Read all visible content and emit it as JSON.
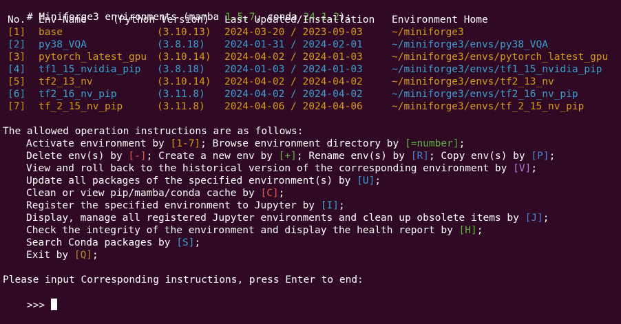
{
  "header": {
    "prefix": "# Miniforge3 environments (mamba ",
    "mamba_version": "1.5.7",
    "middle": ", conda ",
    "conda_version": "24.1.2",
    "suffix": "):"
  },
  "columns": {
    "no": "No.",
    "name": "Env Name",
    "python": "(Python Version)",
    "updated": "Last Updated/Installation",
    "home": "Environment Home"
  },
  "environments": [
    {
      "no": "[1]",
      "name": "base",
      "python": "(3.10.13)",
      "updated": "2024-03-20 / 2023-09-03",
      "home": "~/miniforge3",
      "color": "#d49a1a"
    },
    {
      "no": "[2]",
      "name": "py38_VQA",
      "python": "(3.8.18)",
      "updated": "2024-01-31 / 2024-02-01",
      "home": "~/miniforge3/envs/py38_VQA",
      "color": "#3aa0d0"
    },
    {
      "no": "[3]",
      "name": "pytorch_latest_gpu",
      "python": "(3.10.14)",
      "updated": "2024-04-02 / 2024-01-03",
      "home": "~/miniforge3/envs/pytorch_latest_gpu",
      "color": "#d49a1a"
    },
    {
      "no": "[4]",
      "name": "tf1_15_nvidia_pip",
      "python": "(3.8.18)",
      "updated": "2024-01-03 / 2024-01-03",
      "home": "~/miniforge3/envs/tf1_15_nvidia_pip",
      "color": "#3aa0d0"
    },
    {
      "no": "[5]",
      "name": "tf2_13_nv",
      "python": "(3.10.14)",
      "updated": "2024-04-02 / 2024-04-02",
      "home": "~/miniforge3/envs/tf2_13_nv",
      "color": "#d49a1a"
    },
    {
      "no": "[6]",
      "name": "tf2_16_nv_pip",
      "python": "(3.11.8)",
      "updated": "2024-04-02 / 2024-04-02",
      "home": "~/miniforge3/envs/tf2_16_nv_pip",
      "color": "#3aa0d0"
    },
    {
      "no": "[7]",
      "name": "tf_2_15_nv_pip",
      "python": "(3.11.8)",
      "updated": "2024-04-06 / 2024-04-06",
      "home": "~/miniforge3/envs/tf_2_15_nv_pip",
      "color": "#d49a1a"
    }
  ],
  "instructions_title": "The allowed operation instructions are as follows:",
  "instructions": [
    [
      [
        "Activate environment by ",
        "#ffffff"
      ],
      [
        "[1-7]",
        "#d49a1a"
      ],
      [
        "; Browse environment directory by ",
        "#ffffff"
      ],
      [
        "[=number]",
        "#5fb53f"
      ],
      [
        ";",
        "#ffffff"
      ]
    ],
    [
      [
        "Delete env(s) by ",
        "#ffffff"
      ],
      [
        "[-]",
        "#e8564a"
      ],
      [
        "; Create a new env by ",
        "#ffffff"
      ],
      [
        "[+]",
        "#5fb53f"
      ],
      [
        "; Rename env(s) by ",
        "#ffffff"
      ],
      [
        "[R]",
        "#4a83d4"
      ],
      [
        "; Copy env(s) by ",
        "#ffffff"
      ],
      [
        "[P]",
        "#4a83d4"
      ],
      [
        ";",
        "#ffffff"
      ]
    ],
    [
      [
        "View and roll back to the historical version of the corresponding environment by ",
        "#ffffff"
      ],
      [
        "[V]",
        "#b07ad8"
      ],
      [
        ";",
        "#ffffff"
      ]
    ],
    [
      [
        "Update all packages of the specified environment(s) by ",
        "#ffffff"
      ],
      [
        "[U]",
        "#3aa0d0"
      ],
      [
        ";",
        "#ffffff"
      ]
    ],
    [
      [
        "Clean or view pip/mamba/conda cache by ",
        "#ffffff"
      ],
      [
        "[C]",
        "#e8564a"
      ],
      [
        ";",
        "#ffffff"
      ]
    ],
    [
      [
        "Register the specified environment to Jupyter by ",
        "#ffffff"
      ],
      [
        "[I]",
        "#3aa0d0"
      ],
      [
        ";",
        "#ffffff"
      ]
    ],
    [
      [
        "Display, manage all registered Jupyter environments and clean up obsolete items by ",
        "#ffffff"
      ],
      [
        "[J]",
        "#4a83d4"
      ],
      [
        ";",
        "#ffffff"
      ]
    ],
    [
      [
        "Check the integrity of the environment and display the health report by ",
        "#ffffff"
      ],
      [
        "[H]",
        "#5fb53f"
      ],
      [
        ";",
        "#ffffff"
      ]
    ],
    [
      [
        "Search Conda packages by ",
        "#ffffff"
      ],
      [
        "[S]",
        "#3aa0d0"
      ],
      [
        ";",
        "#ffffff"
      ]
    ],
    [
      [
        "Exit by ",
        "#ffffff"
      ],
      [
        "[Q]",
        "#b8892e"
      ],
      [
        ";",
        "#ffffff"
      ]
    ]
  ],
  "prompt_text": "Please input Corresponding instructions, press Enter to end:",
  "prompt_symbol": ">>> "
}
